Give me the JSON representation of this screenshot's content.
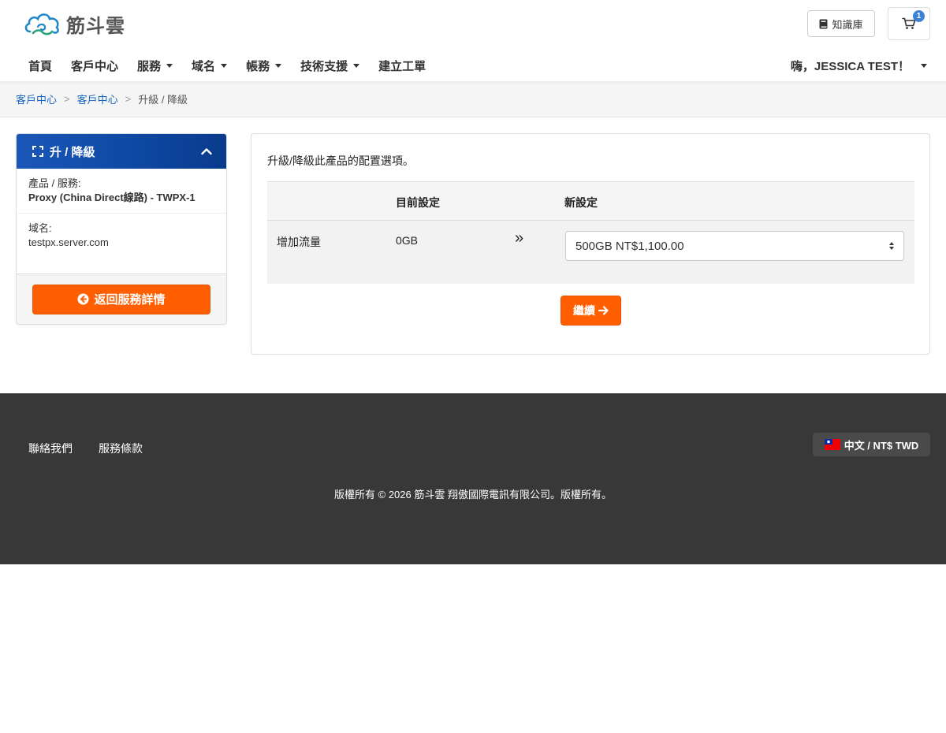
{
  "brand": {
    "name": "筋斗雲"
  },
  "header": {
    "kb_label": "知識庫",
    "cart_count": "1"
  },
  "nav": {
    "items": [
      {
        "label": "首頁",
        "dropdown": false
      },
      {
        "label": "客戶中心",
        "dropdown": false
      },
      {
        "label": "服務",
        "dropdown": true
      },
      {
        "label": "域名",
        "dropdown": true
      },
      {
        "label": "帳務",
        "dropdown": true
      },
      {
        "label": "技術支援",
        "dropdown": true
      },
      {
        "label": "建立工單",
        "dropdown": false
      }
    ],
    "user_greeting": "嗨，JESSICA TEST！"
  },
  "breadcrumb": {
    "items": [
      {
        "label": "客戶中心",
        "link": true
      },
      {
        "label": "客戶中心",
        "link": true
      },
      {
        "label": "升級 / 降級",
        "link": false
      }
    ],
    "separator": ">"
  },
  "sidebar": {
    "title": "升 / 降級",
    "product_label": "產品 / 服務:",
    "product_value": "Proxy (China Direct線路) - TWPX-1",
    "domain_label": "域名:",
    "domain_value": "testpx.server.com",
    "back_button": "返回服務詳情"
  },
  "main": {
    "intro": "升級/降級此產品的配置選項。",
    "table": {
      "headers": [
        "",
        "目前設定",
        "",
        "新設定"
      ],
      "rows": [
        {
          "option": "增加流量",
          "current": "0GB",
          "arrow": "»",
          "selected": "500GB NT$1,100.00"
        }
      ]
    },
    "continue_button": "繼續"
  },
  "footer": {
    "links": [
      "聯絡我們",
      "服務條款"
    ],
    "language": "中文 / NT$ TWD",
    "copyright": "版權所有 © 2026 筋斗雲 翔傲國際電訊有限公司。版權所有。"
  },
  "colors": {
    "accent": "#ff5f00",
    "primary": "#0d47a1",
    "link": "#1565c0",
    "footer_bg": "#383838"
  }
}
